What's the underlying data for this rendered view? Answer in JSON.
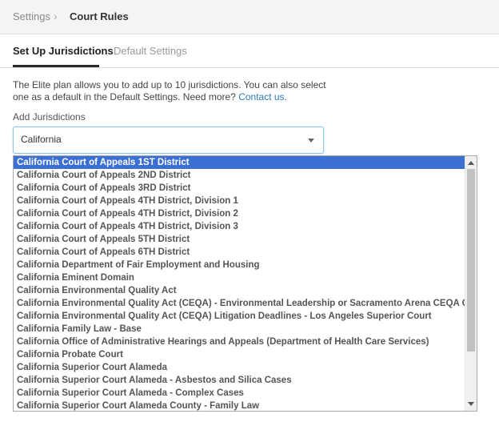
{
  "breadcrumb": {
    "root": "Settings",
    "separator": "›",
    "current": "Court Rules"
  },
  "tabs": [
    {
      "label": "Set Up Jurisdictions",
      "active": true
    },
    {
      "label": "Default Settings",
      "active": false
    }
  ],
  "description": {
    "text": "The Elite plan allows you to add up to 10 jurisdictions. You can also select one as a default in the Default Settings. Need more?",
    "link": "Contact us."
  },
  "add_jurisdictions": {
    "label": "Add Jurisdictions",
    "value": "California"
  },
  "options": [
    "California Court of Appeals 1ST District",
    "California Court of Appeals 2ND District",
    "California Court of Appeals 3RD District",
    "California Court of Appeals 4TH District, Division 1",
    "California Court of Appeals 4TH District, Division 2",
    "California Court of Appeals 4TH District, Division 3",
    "California Court of Appeals 5TH District",
    "California Court of Appeals 6TH District",
    "California Department of Fair Employment and Housing",
    "California Eminent Domain",
    "California Environmental Quality Act",
    "California Environmental Quality Act (CEQA) - Environmental Leadership or Sacramento Arena CEQA Challe",
    "California Environmental Quality Act (CEQA) Litigation Deadlines - Los Angeles Superior Court",
    "California Family Law - Base",
    "California Office of Administrative Hearings and Appeals (Department of Health Care Services)",
    "California Probate Court",
    "California Superior Court Alameda",
    "California Superior Court Alameda - Asbestos and Silica Cases",
    "California Superior Court Alameda - Complex Cases",
    "California Superior Court Alameda County - Family Law"
  ],
  "selected_index": 0,
  "colors": {
    "selected_bg": "#3b6fd4",
    "link": "#2b7bb9",
    "focus_border": "#8fc3e6"
  }
}
